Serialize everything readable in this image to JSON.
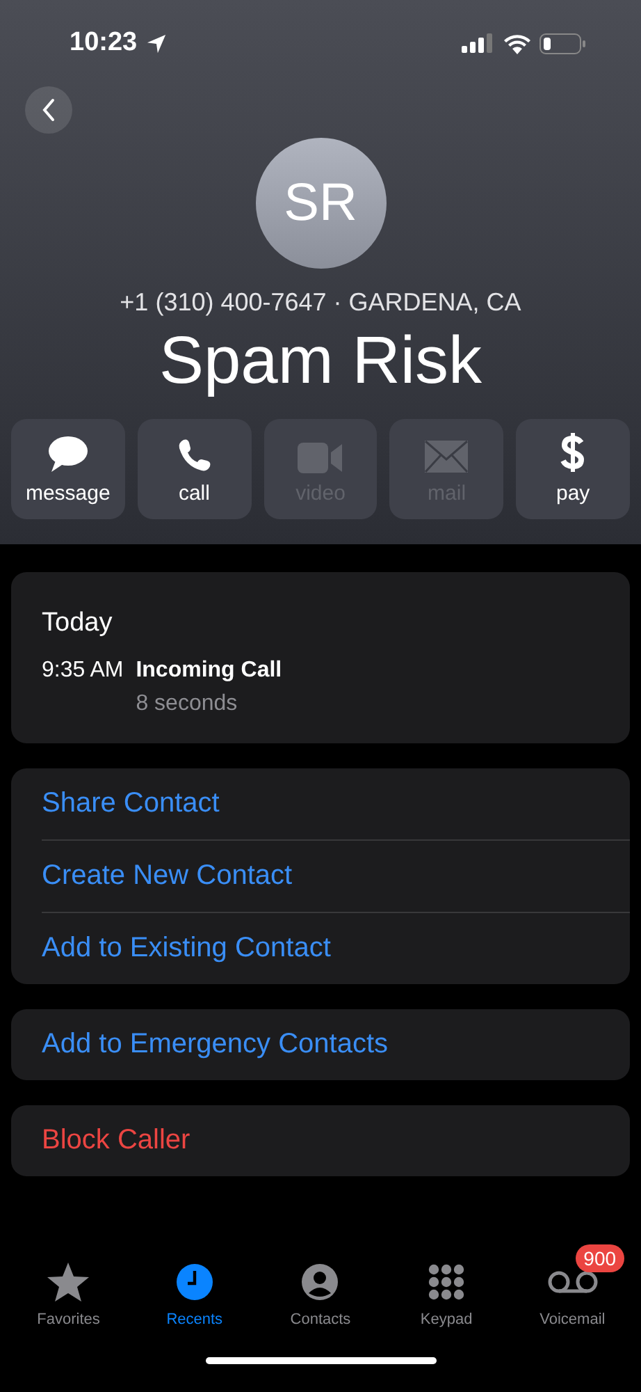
{
  "status_bar": {
    "time": "10:23"
  },
  "contact": {
    "initials": "SR",
    "subtitle": "+1 (310) 400-7647 · GARDENA, CA",
    "name": "Spam Risk"
  },
  "actions": [
    {
      "kind": "message",
      "label": "message",
      "disabled": false
    },
    {
      "kind": "call",
      "label": "call",
      "disabled": false
    },
    {
      "kind": "video",
      "label": "video",
      "disabled": true
    },
    {
      "kind": "mail",
      "label": "mail",
      "disabled": true
    },
    {
      "kind": "pay",
      "label": "pay",
      "disabled": false
    }
  ],
  "call_log": {
    "heading": "Today",
    "entries": [
      {
        "time": "9:35 AM",
        "type": "Incoming Call",
        "duration": "8 seconds"
      }
    ]
  },
  "option_groups": [
    [
      {
        "label": "Share Contact",
        "kind": "normal"
      },
      {
        "label": "Create New Contact",
        "kind": "normal"
      },
      {
        "label": "Add to Existing Contact",
        "kind": "normal"
      }
    ],
    [
      {
        "label": "Add to Emergency Contacts",
        "kind": "normal"
      }
    ],
    [
      {
        "label": "Block Caller",
        "kind": "destructive"
      }
    ]
  ],
  "tabs": [
    {
      "kind": "favorites",
      "label": "Favorites",
      "selected": false
    },
    {
      "kind": "recents",
      "label": "Recents",
      "selected": true
    },
    {
      "kind": "contacts",
      "label": "Contacts",
      "selected": false
    },
    {
      "kind": "keypad",
      "label": "Keypad",
      "selected": false
    },
    {
      "kind": "voicemail",
      "label": "Voicemail",
      "selected": false,
      "badge": "900"
    }
  ]
}
